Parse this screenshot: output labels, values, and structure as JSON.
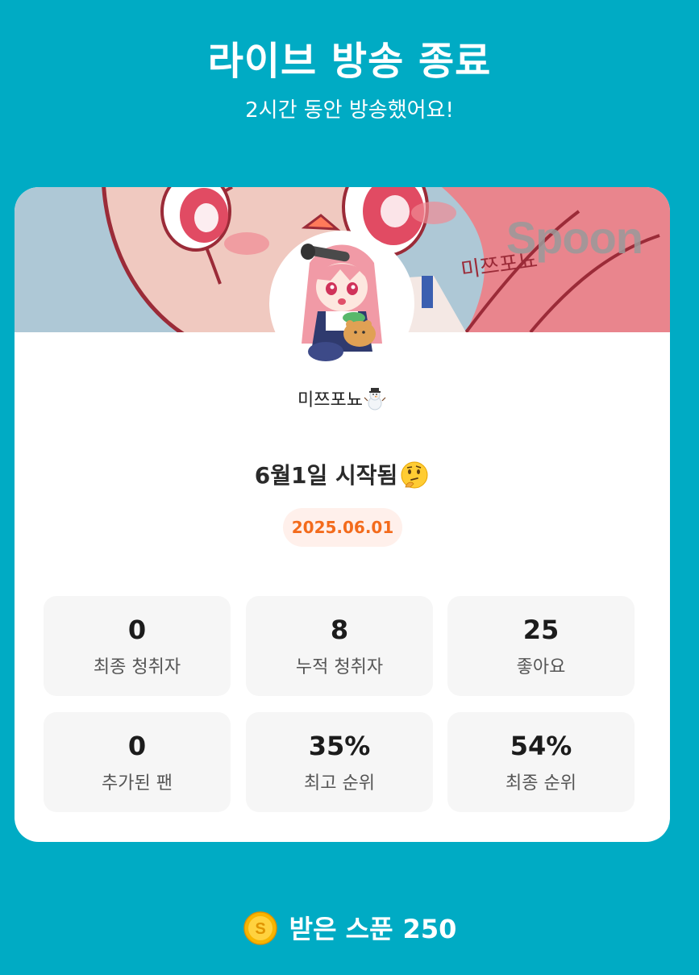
{
  "header": {
    "title": "라이브 방송 종료",
    "subtitle": "2시간 동안 방송했어요!"
  },
  "card": {
    "banner": {
      "brand": "Spoon",
      "sticker_text": "미쯔포뇨"
    },
    "dj": {
      "name": "미쯔포뇨",
      "name_icon": "snowman-icon"
    },
    "live_title": {
      "text": "6월1일 시작됨",
      "icon": "thinking-face-icon"
    },
    "date": "2025.06.01",
    "stats": [
      {
        "value": "0",
        "label": "최종 청취자"
      },
      {
        "value": "8",
        "label": "누적 청취자"
      },
      {
        "value": "25",
        "label": "좋아요"
      },
      {
        "value": "0",
        "label": "추가된 팬"
      },
      {
        "value": "35%",
        "label": "최고 순위"
      },
      {
        "value": "54%",
        "label": "최종 순위"
      }
    ]
  },
  "spoons": {
    "icon": "coin-icon",
    "label": "받은 스푼",
    "count": "250"
  },
  "colors": {
    "background": "#00abc4",
    "card": "#ffffff",
    "date_badge_bg": "#fff0eb",
    "date_badge_text": "#f36b1c",
    "stat_tile": "#f6f6f6"
  }
}
